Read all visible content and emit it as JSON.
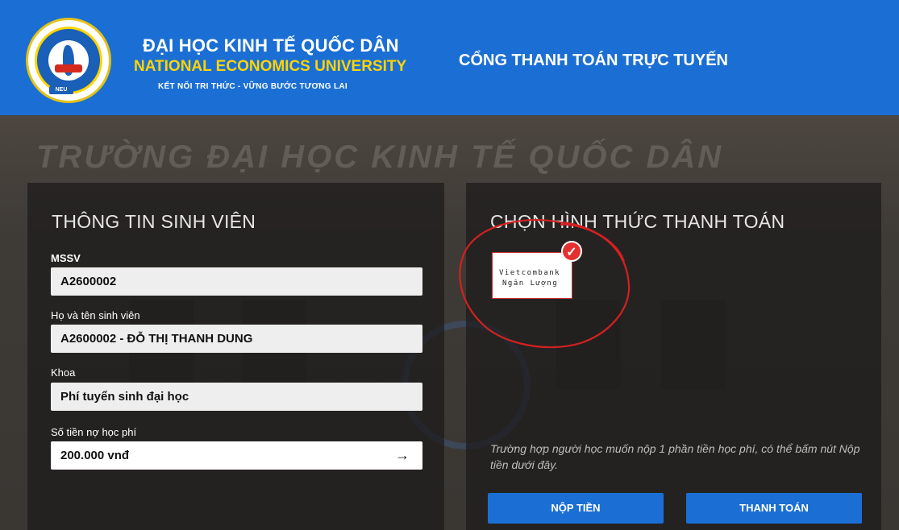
{
  "header": {
    "university_vn": "ĐẠI HỌC KINH TẾ QUỐC DÂN",
    "university_en": "NATIONAL ECONOMICS UNIVERSITY",
    "slogan": "KẾT NỐI TRI THỨC - VỮNG BƯỚC TƯƠNG LAI",
    "portal_title": "CỔNG THANH TOÁN TRỰC TUYẾN",
    "logo_tag": "NEU"
  },
  "background": {
    "banner_text": "TRƯỜNG ĐẠI HỌC KINH TẾ QUỐC DÂN"
  },
  "student": {
    "title": "THÔNG TIN SINH VIÊN",
    "fields": [
      {
        "label": "MSSV",
        "value": "A2600002"
      },
      {
        "label": "Họ và tên sinh viên",
        "value": "A2600002 - ĐỖ THỊ THANH DUNG"
      },
      {
        "label": "Khoa",
        "value": "Phí tuyển sinh đại học"
      },
      {
        "label": "Số tiền nợ học phí",
        "value": "200.000 vnđ"
      }
    ]
  },
  "payment": {
    "title": "CHỌN HÌNH THỨC THANH TOÁN",
    "method_line1": "Vietcombank",
    "method_line2": "Ngân Lượng",
    "note": "Trường hợp người học muốn nộp 1 phần tiền học phí, có thể bấm nút Nộp tiền dưới đây.",
    "deposit_label": "NỘP TIỀN",
    "pay_label": "THANH TOÁN"
  },
  "colors": {
    "brand_blue": "#1b6fd4",
    "accent_yellow": "#ffd400",
    "annotation_red": "#d42020"
  }
}
